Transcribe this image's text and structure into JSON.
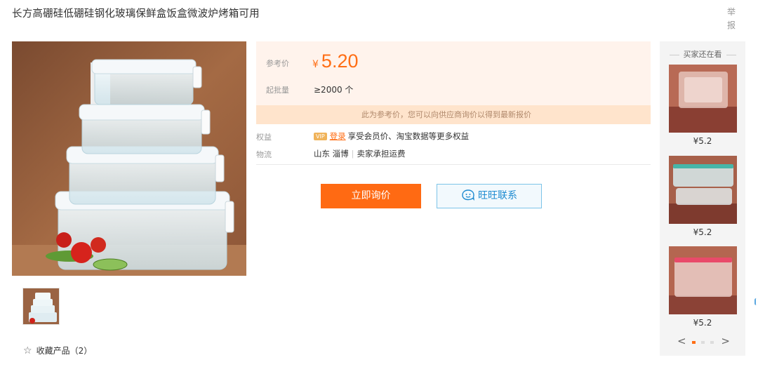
{
  "product": {
    "title": "长方高硼硅低硼硅钢化玻璃保鲜盒饭盒微波炉烤箱可用",
    "report_label": "举报"
  },
  "gallery": {
    "favorite_label": "收藏产品（2）"
  },
  "pricing": {
    "price_label": "参考价",
    "currency_symbol": "¥",
    "price_value": "5.20",
    "moq_label": "起批量",
    "moq_value": "≥2000 个",
    "notice": "此为参考价，您可以向供应商询价以得到最新报价"
  },
  "benefits": {
    "label": "权益",
    "vip_badge": "VIP",
    "login_link": "登录",
    "text": "享受会员价、淘宝数据等更多权益"
  },
  "logistics": {
    "label": "物流",
    "origin": "山东 淄博",
    "shipping": "卖家承担运费"
  },
  "actions": {
    "inquire_label": "立即询价",
    "wangwang_label": "旺旺联系"
  },
  "sidebar": {
    "title": "买家还在看",
    "items": [
      {
        "price": "¥5.2"
      },
      {
        "price": "¥5.2"
      },
      {
        "price": "¥5.2"
      }
    ],
    "pager": {
      "pages": 3,
      "active": 1
    }
  },
  "icons": {
    "star": "star-outline-icon",
    "wangwang": "wangwang-chat-icon",
    "prev": "chevron-left-icon",
    "next": "chevron-right-icon"
  },
  "colors": {
    "accent": "#ff6e15",
    "price_panel_bg": "#fff3ec",
    "notice_bg": "#ffe4cc",
    "wangwang_blue": "#1d8ad0"
  }
}
